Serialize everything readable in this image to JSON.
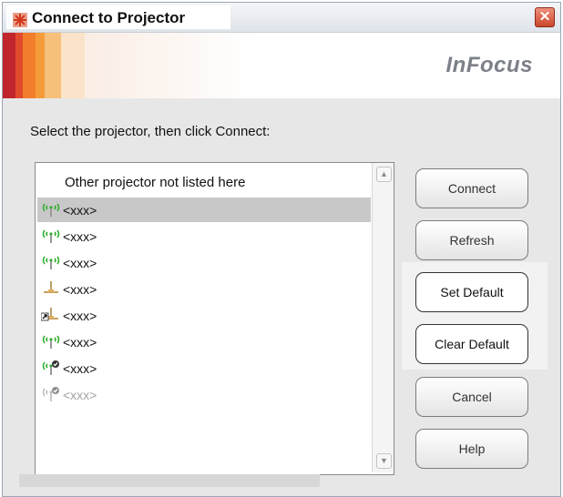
{
  "window": {
    "title": "Connect to Projector",
    "close_label": "✕",
    "brand": "InFocus"
  },
  "instruction": "Select the projector, then click Connect:",
  "projector_list": {
    "items": [
      {
        "label": "Other projector not listed here",
        "icon": "none",
        "state": "normal"
      },
      {
        "label": "<xxx>",
        "icon": "wireless-signal-icon",
        "state": "selected"
      },
      {
        "label": "<xxx>",
        "icon": "wireless-signal-icon",
        "state": "normal"
      },
      {
        "label": "<xxx>",
        "icon": "wireless-signal-icon",
        "state": "normal"
      },
      {
        "label": "<xxx>",
        "icon": "wired-network-icon",
        "state": "normal"
      },
      {
        "label": "<xxx>",
        "icon": "wired-network-shortcut-icon",
        "state": "normal"
      },
      {
        "label": "<xxx>",
        "icon": "wireless-signal-icon",
        "state": "normal"
      },
      {
        "label": "<xxx>",
        "icon": "wireless-secured-icon",
        "state": "normal"
      },
      {
        "label": "<xxx>",
        "icon": "wireless-secured-disabled-icon",
        "state": "disabled"
      }
    ]
  },
  "buttons": {
    "connect": "Connect",
    "refresh": "Refresh",
    "set_default": "Set Default",
    "clear_default": "Clear Default",
    "cancel": "Cancel",
    "help": "Help"
  },
  "colors": {
    "selection": "#c8c8c8",
    "signal_green": "#2fae2f",
    "close_red": "#d9533a"
  }
}
